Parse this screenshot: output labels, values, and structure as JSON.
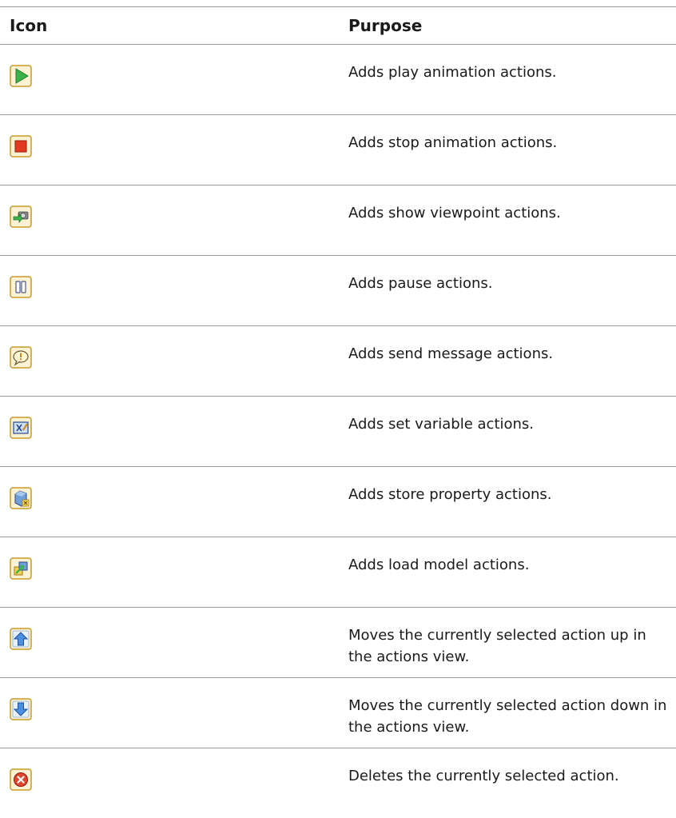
{
  "table": {
    "header": {
      "icon": "Icon",
      "purpose": "Purpose"
    },
    "rows": [
      {
        "icon": "play-icon",
        "purpose": "Adds play animation actions."
      },
      {
        "icon": "stop-icon",
        "purpose": "Adds stop animation actions."
      },
      {
        "icon": "show-viewpoint-icon",
        "purpose": "Adds show viewpoint actions."
      },
      {
        "icon": "pause-icon",
        "purpose": "Adds pause actions."
      },
      {
        "icon": "send-message-icon",
        "purpose": "Adds send message actions."
      },
      {
        "icon": "set-variable-icon",
        "purpose": "Adds set variable actions."
      },
      {
        "icon": "store-property-icon",
        "purpose": "Adds store property actions."
      },
      {
        "icon": "load-model-icon",
        "purpose": "Adds load model actions."
      },
      {
        "icon": "move-up-icon",
        "purpose": "Moves the currently selected action up in the actions view."
      },
      {
        "icon": "move-down-icon",
        "purpose": "Moves the currently selected action down in the actions view."
      },
      {
        "icon": "delete-icon",
        "purpose": "Deletes the currently selected action."
      }
    ]
  },
  "colors": {
    "rule": "#999999",
    "button_border": "#c89a28",
    "button_fill": "#fdf3d4"
  }
}
